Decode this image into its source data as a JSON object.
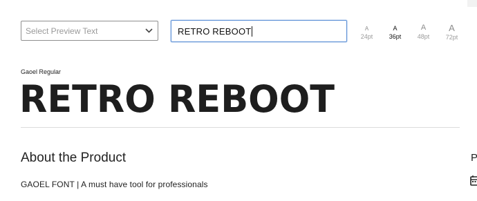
{
  "preview_select": {
    "placeholder": "Select Preview Text"
  },
  "preview_input": {
    "value": "RETRO REBOOT"
  },
  "size_options": [
    {
      "label": "A",
      "size": "24pt",
      "active": false
    },
    {
      "label": "A",
      "size": "36pt",
      "active": true
    },
    {
      "label": "A",
      "size": "48pt",
      "active": false
    },
    {
      "label": "A",
      "size": "72pt",
      "active": false
    }
  ],
  "font_name": "Gaoel Regular",
  "preview_text": "RETRO REBOOT",
  "about": {
    "title": "About the Product",
    "subtitle": "GAOEL FONT | A must have tool for professionals"
  },
  "side_panel": {
    "heading_letter": "P"
  },
  "icons": {
    "dropdown": "chevron-down-icon",
    "side": "calendar-icon"
  }
}
